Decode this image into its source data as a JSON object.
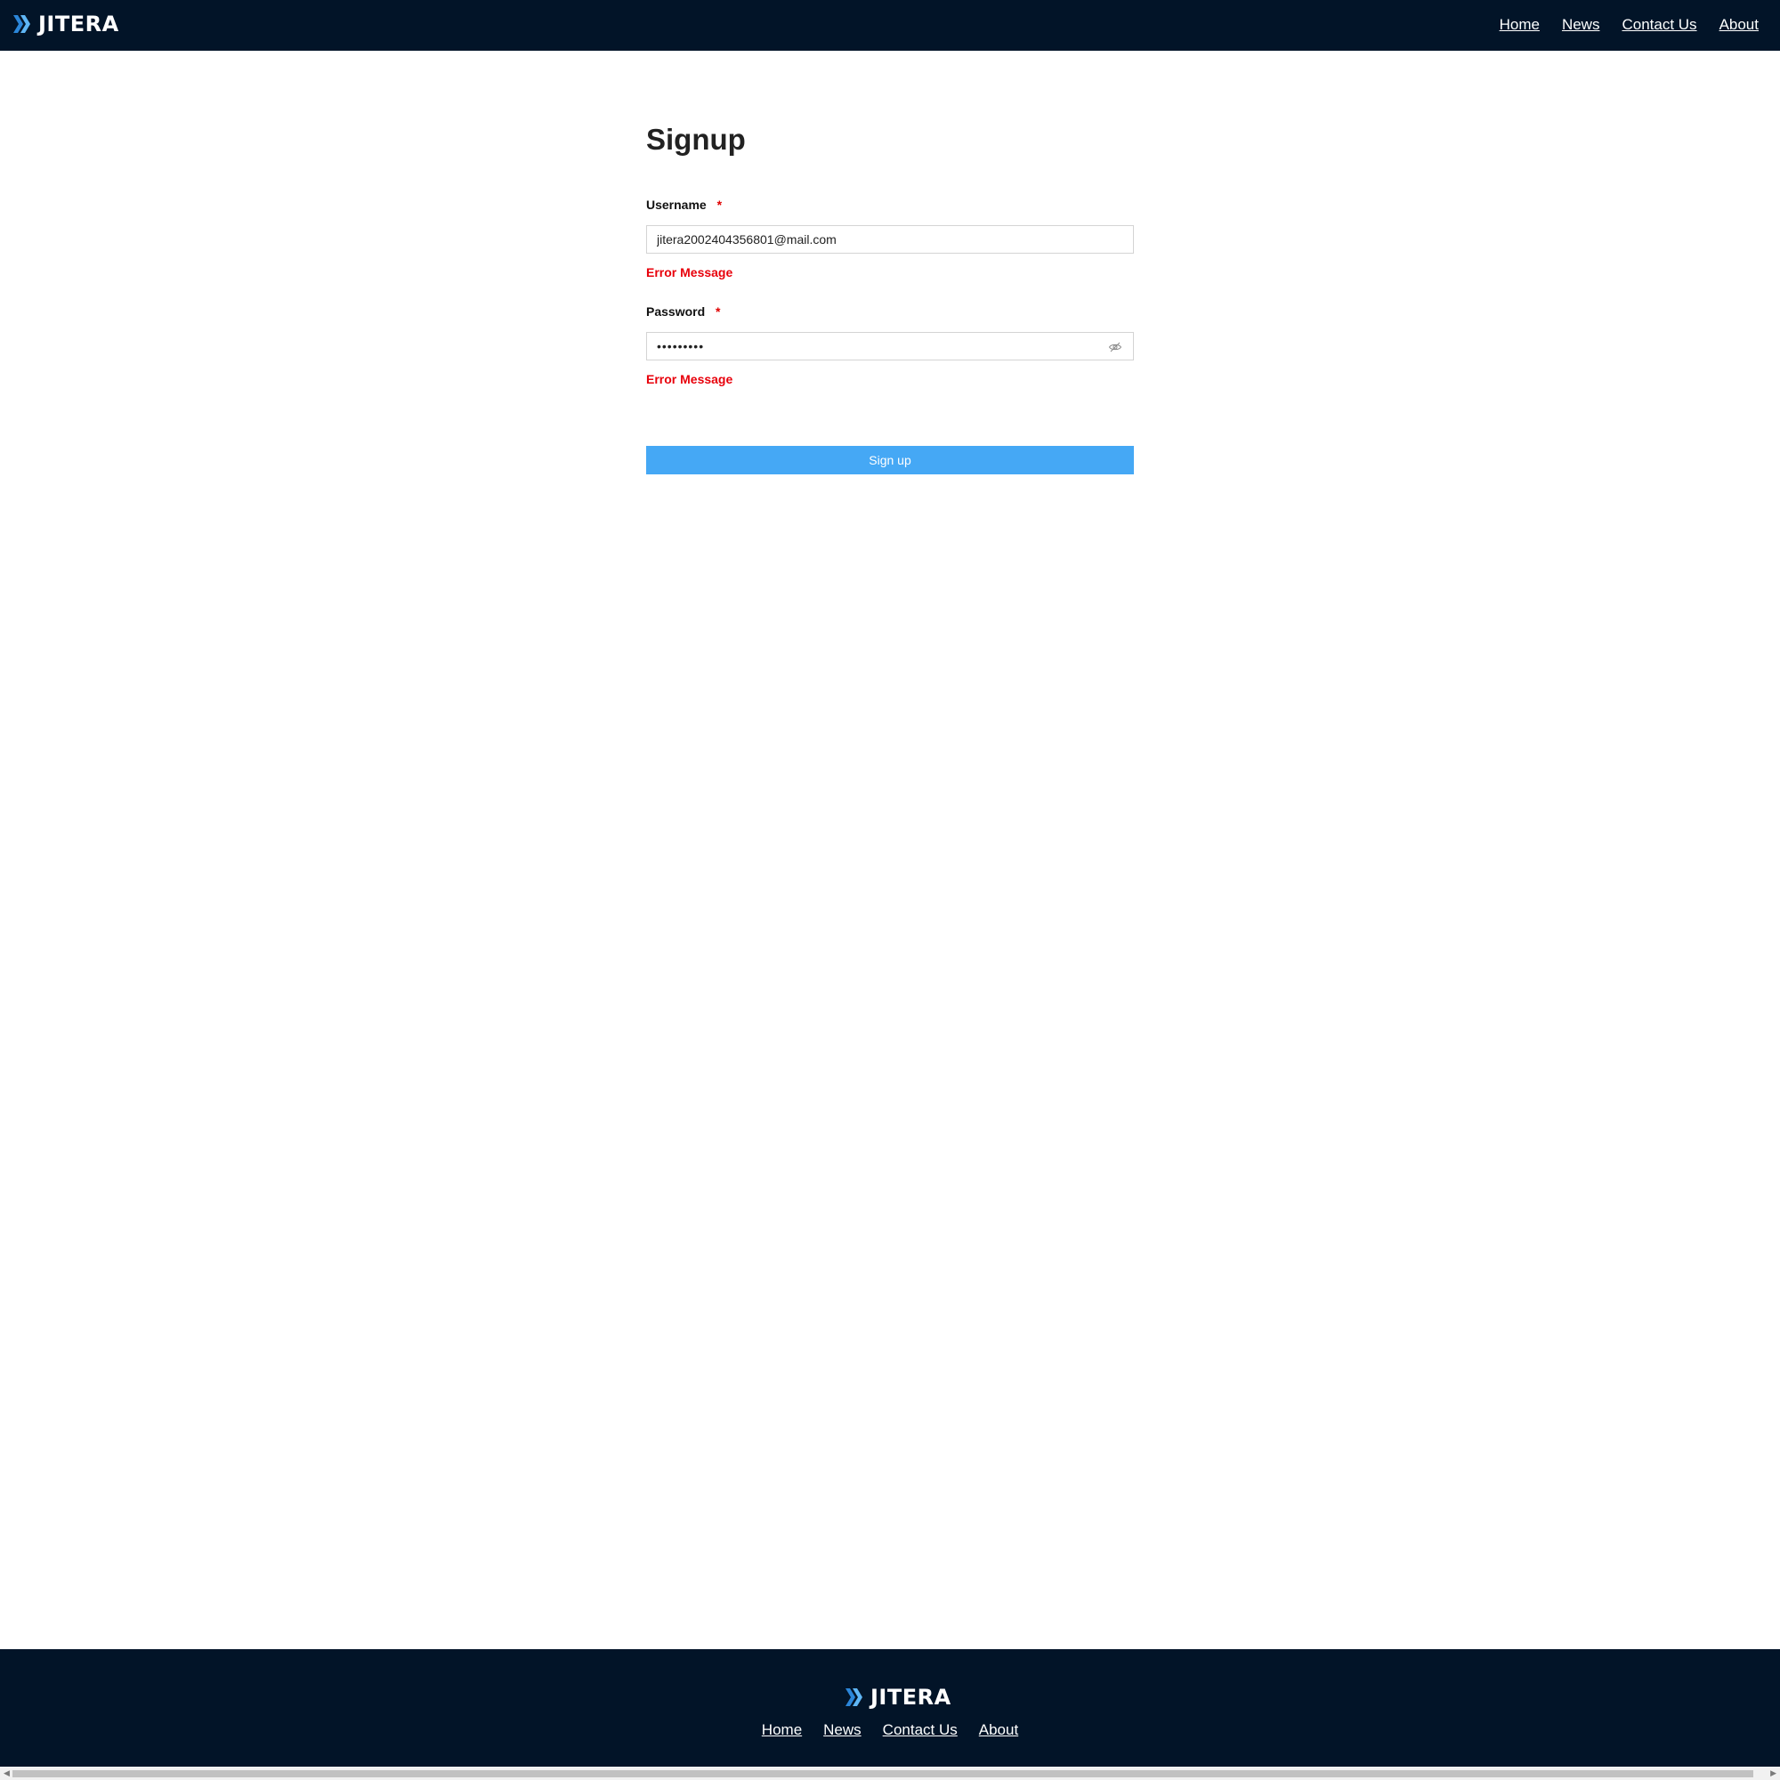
{
  "header": {
    "brand": "JITERA",
    "nav": [
      "Home",
      "News",
      "Contact Us",
      "About"
    ]
  },
  "form": {
    "title": "Signup",
    "username": {
      "label": "Username",
      "required_mark": "*",
      "value": "jitera2002404356801@mail.com",
      "error": "Error Message"
    },
    "password": {
      "label": "Password",
      "required_mark": "*",
      "value": "•••••••••",
      "error": "Error Message"
    },
    "submit_label": "Sign up"
  },
  "footer": {
    "brand": "JITERA",
    "nav": [
      "Home",
      "News",
      "Contact Us",
      "About"
    ]
  },
  "colors": {
    "header_bg": "#021428",
    "button_bg": "#45a8f5",
    "error": "#e8000b"
  },
  "icons": {
    "logo": "double-chevron-right-icon",
    "password_toggle": "eye-slash-icon"
  }
}
